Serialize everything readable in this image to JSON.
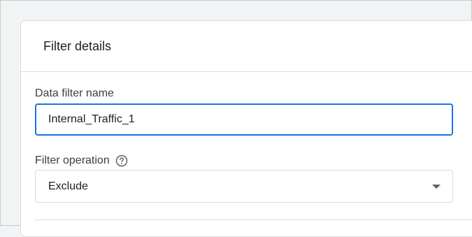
{
  "card": {
    "title": "Filter details"
  },
  "data_filter_name": {
    "label": "Data filter name",
    "value": "Internal_Traffic_1"
  },
  "filter_operation": {
    "label": "Filter operation",
    "help_icon": "help-circle-icon",
    "selected": "Exclude",
    "dropdown_icon": "dropdown-arrow-icon"
  },
  "colors": {
    "accent": "#1a73e8",
    "border": "#dadce0",
    "text": "#202124"
  }
}
